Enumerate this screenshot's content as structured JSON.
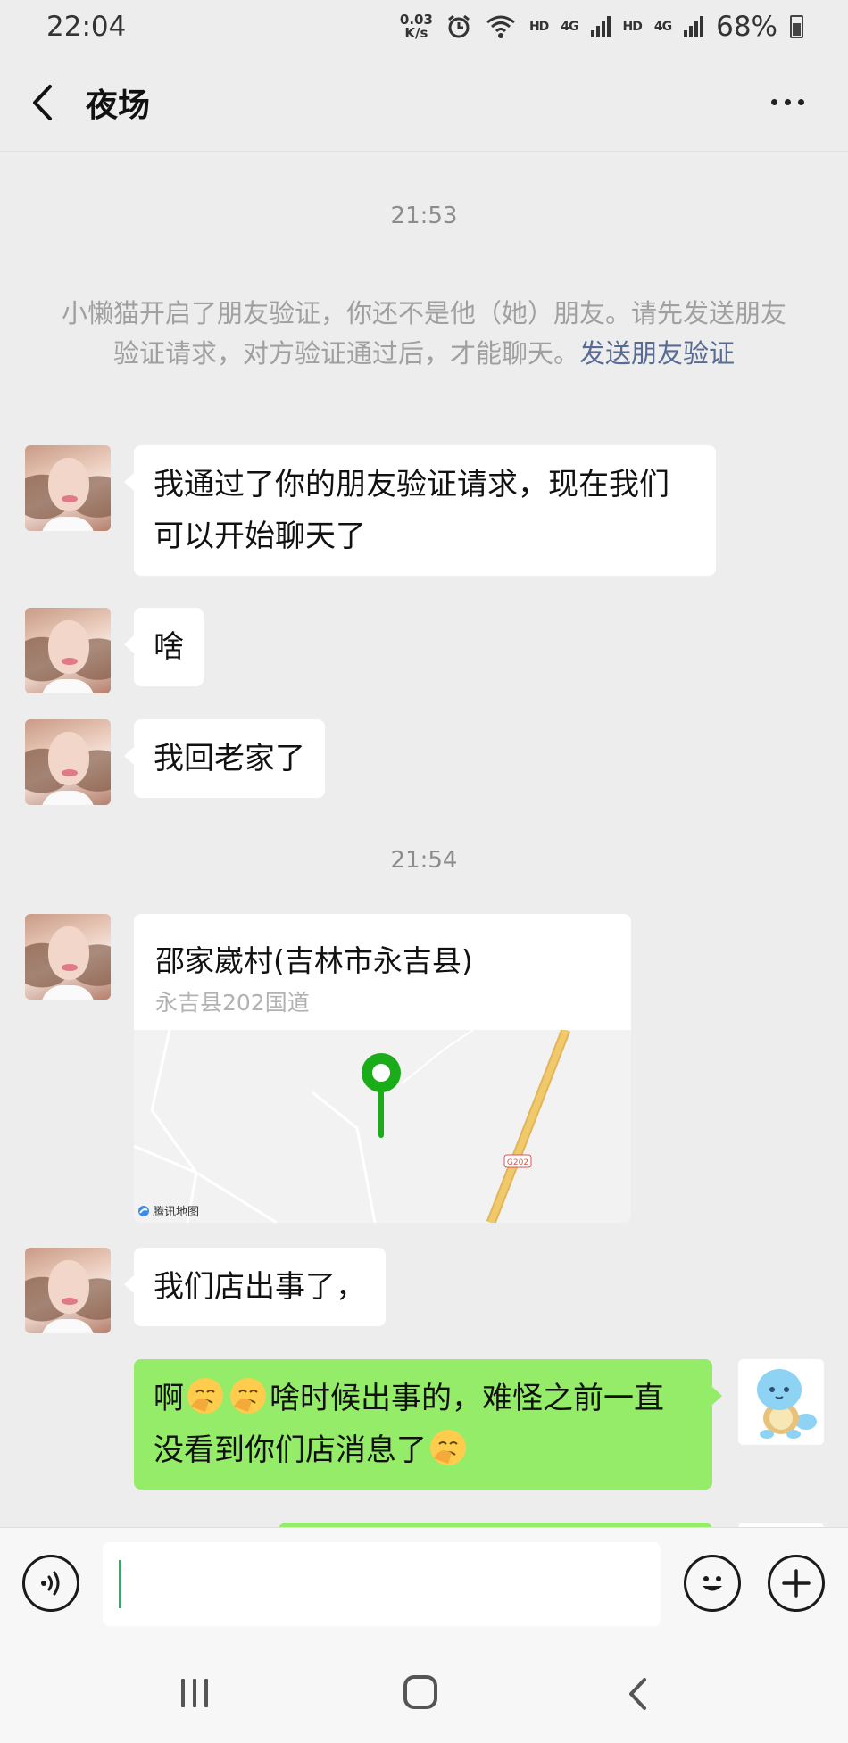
{
  "status_bar": {
    "time": "22:04",
    "net_speed_value": "0.03",
    "net_speed_unit": "K/s",
    "sim1_label": "HD",
    "sim1_gen": "4G",
    "sim2_label": "HD",
    "sim2_gen": "4G",
    "battery": "68%"
  },
  "header": {
    "title": "夜场"
  },
  "chat": {
    "timestamp_1": "21:53",
    "system_message": "小懒猫开启了朋友验证，你还不是他（她）朋友。请先发送朋友验证请求，对方验证通过后，才能聊天。",
    "system_link": "发送朋友验证",
    "msg_1": "我通过了你的朋友验证请求，现在我们可以开始聊天了",
    "msg_2": "啥",
    "msg_3": "我回老家了",
    "timestamp_2": "21:54",
    "location": {
      "title": "邵家崴村(吉林市永吉县)",
      "address": "永吉县202国道",
      "road_label": "G202",
      "map_credit": "腾讯地图"
    },
    "msg_4": "我们店出事了，",
    "my_msg_1_part1": "啊",
    "my_msg_1_part2": "啥时候出事的，难怪之前一直没看到你们店消息了"
  },
  "colors": {
    "background": "#ededed",
    "my_bubble": "#95ec69",
    "link": "#576b95",
    "map_pin": "#1aad19",
    "road": "#f0c96a"
  },
  "icons": [
    "back-arrow-icon",
    "more-icon",
    "voice-icon",
    "emoji-icon",
    "plus-icon",
    "map-pin-icon",
    "facepalm-emoji-icon"
  ]
}
